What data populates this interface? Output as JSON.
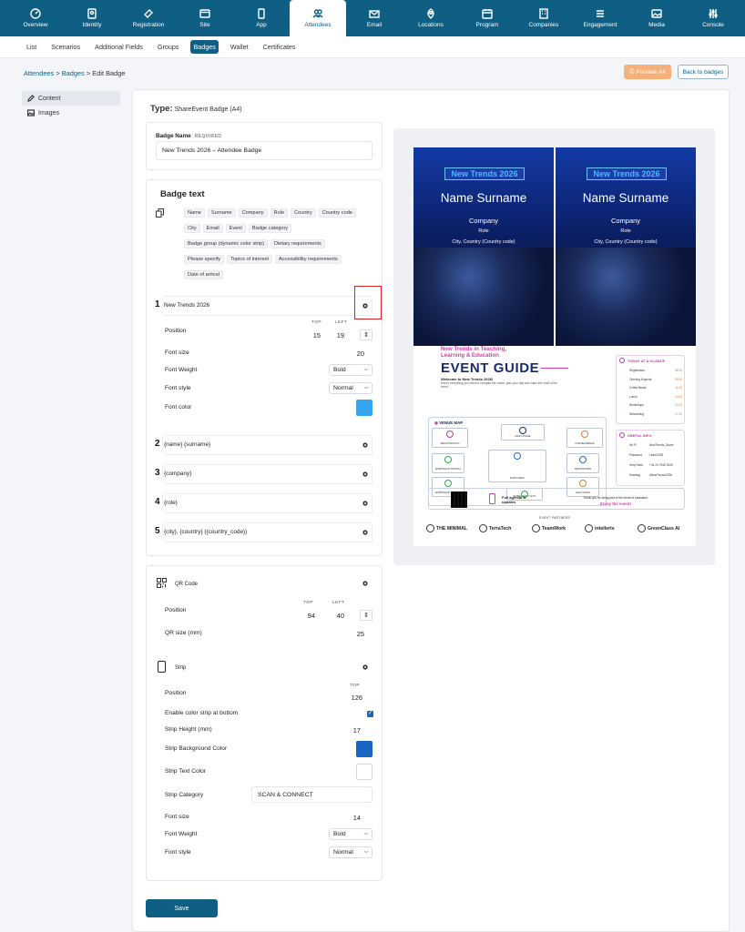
{
  "nav": [
    {
      "label": "Overview",
      "icon": "gauge-icon"
    },
    {
      "label": "Identity",
      "icon": "id-card-icon"
    },
    {
      "label": "Registration",
      "icon": "ticket-icon"
    },
    {
      "label": "Site",
      "icon": "browser-icon"
    },
    {
      "label": "App",
      "icon": "phone-icon"
    },
    {
      "label": "Attendees",
      "icon": "users-icon",
      "active": true
    },
    {
      "label": "Email",
      "icon": "email-icon"
    },
    {
      "label": "Locations",
      "icon": "map-pin-icon"
    },
    {
      "label": "Program",
      "icon": "calendar-icon"
    },
    {
      "label": "Companies",
      "icon": "building-icon"
    },
    {
      "label": "Engagement",
      "icon": "engagement-icon"
    },
    {
      "label": "Media",
      "icon": "image-icon"
    },
    {
      "label": "Console",
      "icon": "sliders-icon"
    }
  ],
  "subnav": [
    {
      "label": "List"
    },
    {
      "label": "Scenarios"
    },
    {
      "label": "Additional Fields"
    },
    {
      "label": "Groups"
    },
    {
      "label": "Badges",
      "active": true
    },
    {
      "label": "Wallet"
    },
    {
      "label": "Certificates"
    }
  ],
  "breadcrumb": {
    "attendees": "Attendees",
    "sep1": ">",
    "badges": "Badges",
    "sep2": ">",
    "current": "Edit Badge"
  },
  "actions": {
    "preview": "Preview A4",
    "back": "Back to badges"
  },
  "sidebar": [
    {
      "label": "Content",
      "icon": "pencil-icon",
      "active": true
    },
    {
      "label": "Images",
      "icon": "image-icon"
    }
  ],
  "type": {
    "label": "Type:",
    "value": "ShareEvent Badge (A4)"
  },
  "badge_name": {
    "label": "Badge Name",
    "required": "REQUIRED",
    "value": "New Trends 2026 – Attendee Badge"
  },
  "badge_text": {
    "title": "Badge text",
    "chips": [
      "Name",
      "Surname",
      "Company",
      "Role",
      "Country",
      "Country code",
      "City",
      "Email",
      "Event",
      "Badge category",
      "Badge group (dynamic color strip)",
      "Dietary requirements",
      "Please specify",
      "Topics of interest",
      "Accessibility requirements",
      "Date of arrival"
    ],
    "lines": [
      {
        "num": "1",
        "text": "New Trends 2026"
      },
      {
        "num": "2",
        "text": "{name} {surname}"
      },
      {
        "num": "3",
        "text": "{company}"
      },
      {
        "num": "4",
        "text": "{role}"
      },
      {
        "num": "5",
        "text": "{city}, {country} ({country_code})"
      }
    ],
    "line1": {
      "position_label": "Position",
      "top_label": "TOP",
      "left_label": "LEFT",
      "top": "15",
      "left": "19",
      "font_size_label": "Font size",
      "font_size": "20",
      "font_weight_label": "Font Weight",
      "font_weight": "Bold",
      "font_style_label": "Font style",
      "font_style": "Normal",
      "font_color_label": "Font color",
      "font_color": "#35a7f2"
    }
  },
  "qr": {
    "title": "QR Code",
    "position_label": "Position",
    "top_label": "TOP",
    "left_label": "LEFT",
    "top": "94",
    "left": "40",
    "size_label": "QR size (mm)",
    "size": "25"
  },
  "strip": {
    "title": "Strip",
    "position_label": "Position",
    "top_label": "TOP",
    "top": "126",
    "enable_label": "Enable color strip at bottom",
    "height_label": "Strip Height (mm)",
    "height": "17",
    "bg_label": "Strip Background Color",
    "bg_color": "#1a64c2",
    "text_color_label": "Strip Text Color",
    "text_color": "#ffffff",
    "category_label": "Strip Category",
    "category": "SCAN & CONNECT",
    "font_size_label": "Font size",
    "font_size": "14",
    "font_weight_label": "Font Weight",
    "font_weight": "Bold",
    "font_style_label": "Font style",
    "font_style": "Normal"
  },
  "save": "Save",
  "preview": {
    "tag": "New Trends 2026",
    "name": "Name Surname",
    "company": "Company",
    "role": "Role",
    "city": "City, Country (Country code)",
    "guide_kicker1": "New Trends in Teaching,",
    "guide_kicker2": "Learning & Education",
    "guide_title": "EVENT GUIDE",
    "guide_welcome": "Welcome to New Trends 2026!",
    "guide_desc": "Here's everything you need to navigate the venue, plan your day and make the most of the event.",
    "venue_map": "VENUE MAP",
    "rooms": [
      "REGISTRATION",
      "MAIN STAGE",
      "COFFEE BREAK",
      "WORKSHOP ROOM A",
      "EXPO AREA",
      "RESTROOMS",
      "WORKSHOP ROOM B",
      "EMERGENCY EXIT",
      "HELP DESK"
    ],
    "glance_title": "TODAY AT A GLANCE",
    "glance": [
      {
        "t": "Registration",
        "v": "08:30"
      },
      {
        "t": "Opening Keynote",
        "v": "09:30"
      },
      {
        "t": "Coffee Break",
        "v": "11:00"
      },
      {
        "t": "Lunch",
        "v": "13:00"
      },
      {
        "t": "Workshops",
        "v": "14:30"
      },
      {
        "t": "Networking",
        "v": "17:00"
      }
    ],
    "useful_title": "USEFUL INFO",
    "useful": [
      {
        "t": "Wi-Fi",
        "v": "NewTrends_Guest"
      },
      {
        "t": "Password",
        "v": "Learn2026"
      },
      {
        "t": "Help Desk",
        "v": "+44 20 7946 2026"
      },
      {
        "t": "Hashtag",
        "v": "#NewTrends2026"
      }
    ],
    "agenda": "Full agenda & updates",
    "thanks": "Thank you for being part of the future of education.",
    "enjoy": "Enjoy the event!",
    "partners": "EVENT PARTNERS",
    "logos": [
      "THE MINIMAL",
      "TerraTech",
      "TeamWork",
      "intellerts",
      "GreenClass AI"
    ]
  }
}
